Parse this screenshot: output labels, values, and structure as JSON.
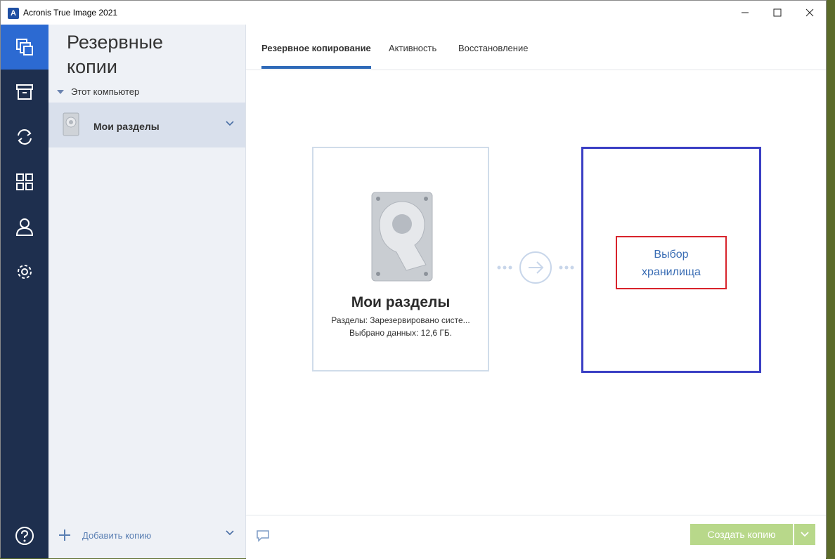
{
  "window": {
    "title": "Acronis True Image 2021",
    "app_icon_letter": "A"
  },
  "sidebar": {
    "title_line1": "Резервные",
    "title_line2": "копии",
    "group_label": "Этот компьютер",
    "entry_label": "Мои разделы",
    "add_label": "Добавить копию"
  },
  "tabs": [
    {
      "label": "Резервное копирование",
      "active": true
    },
    {
      "label": "Активность",
      "active": false
    },
    {
      "label": "Восстановление",
      "active": false
    }
  ],
  "source": {
    "name": "Мои разделы",
    "partitions": "Разделы: Зарезервировано систе...",
    "selected": "Выбрано данных: 12,6 ГБ."
  },
  "destination": {
    "label_line1": "Выбор",
    "label_line2": "хранилища"
  },
  "footer": {
    "create_label": "Создать копию"
  },
  "colors": {
    "rail": "#1e2f4e",
    "rail_active": "#2c6ad2",
    "accent": "#2f6ab8",
    "create_button": "#b8d88a",
    "destination_border": "#3a3fc4",
    "highlight_border": "#d8242c"
  }
}
